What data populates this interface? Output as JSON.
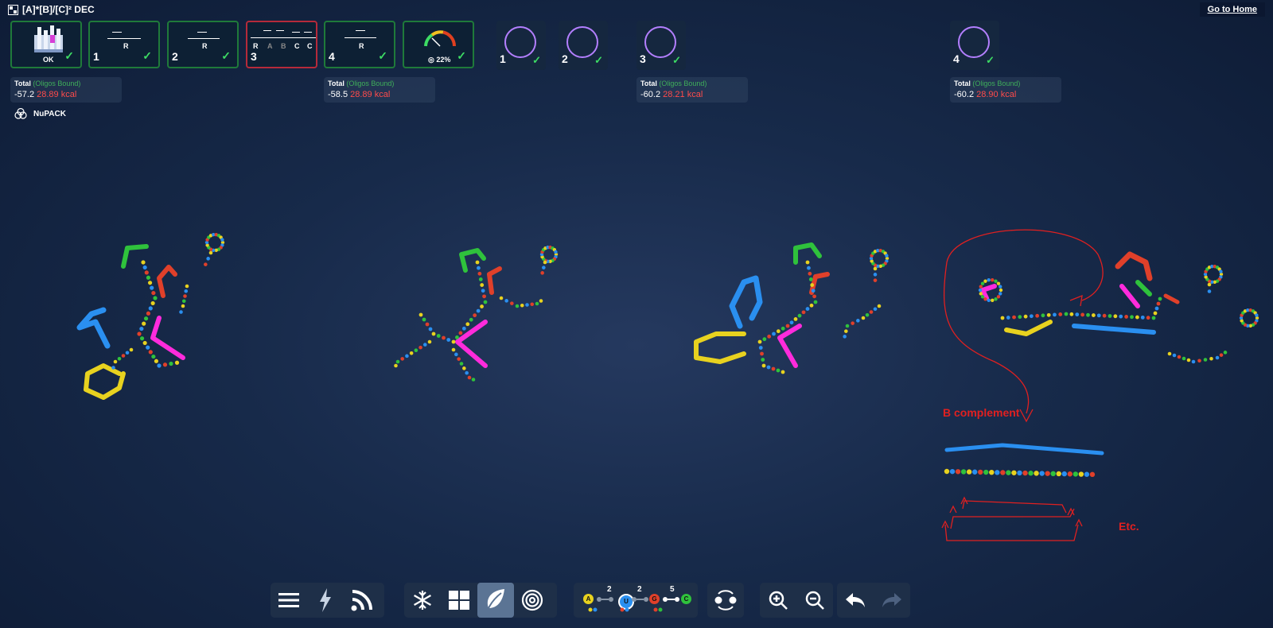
{
  "header": {
    "title": "[A]*[B]/[C]² DEC",
    "home_label": "Go to Home"
  },
  "states": [
    {
      "num": "",
      "caption": "OK",
      "icon": "oligo-stack-icon"
    },
    {
      "num": "1",
      "labels": [
        "R"
      ]
    },
    {
      "num": "2",
      "labels": [
        "R"
      ]
    },
    {
      "num": "3",
      "labels": [
        "R",
        "A",
        "B",
        "C",
        "C"
      ]
    },
    {
      "num": "4",
      "labels": [
        "R"
      ]
    },
    {
      "num": "",
      "caption": "◎ 22%",
      "icon": "gauge-icon"
    }
  ],
  "targets": [
    "1",
    "2",
    "3",
    "4"
  ],
  "energies": [
    {
      "label": "Total",
      "sub": "(Oligos Bound)",
      "value": "-57.2",
      "kcal": "28.89 kcal"
    },
    {
      "label": "Total",
      "sub": "(Oligos Bound)",
      "value": "-58.5",
      "kcal": "28.89 kcal"
    },
    {
      "label": "Total",
      "sub": "(Oligos Bound)",
      "value": "-60.2",
      "kcal": "28.21 kcal"
    },
    {
      "label": "Total",
      "sub": "(Oligos Bound)",
      "value": "-60.2",
      "kcal": "28.90 kcal"
    }
  ],
  "engine_label": "NuPACK",
  "annotations": {
    "b_complement": "B complement",
    "etc": "Etc."
  },
  "toolbar": {
    "nucleotides": [
      "A",
      "U",
      "G",
      "C"
    ],
    "pair_counts": [
      "2",
      "2",
      "5"
    ]
  },
  "colors": {
    "success": "#3ddc64",
    "error": "#b52a3a",
    "energy_red": "#ff4b4b",
    "target_ring": "#b37fff",
    "nuc_A": "#e8d21f",
    "nuc_U": "#2a8ff0",
    "nuc_G": "#e0402a",
    "nuc_C": "#2fc23c"
  }
}
